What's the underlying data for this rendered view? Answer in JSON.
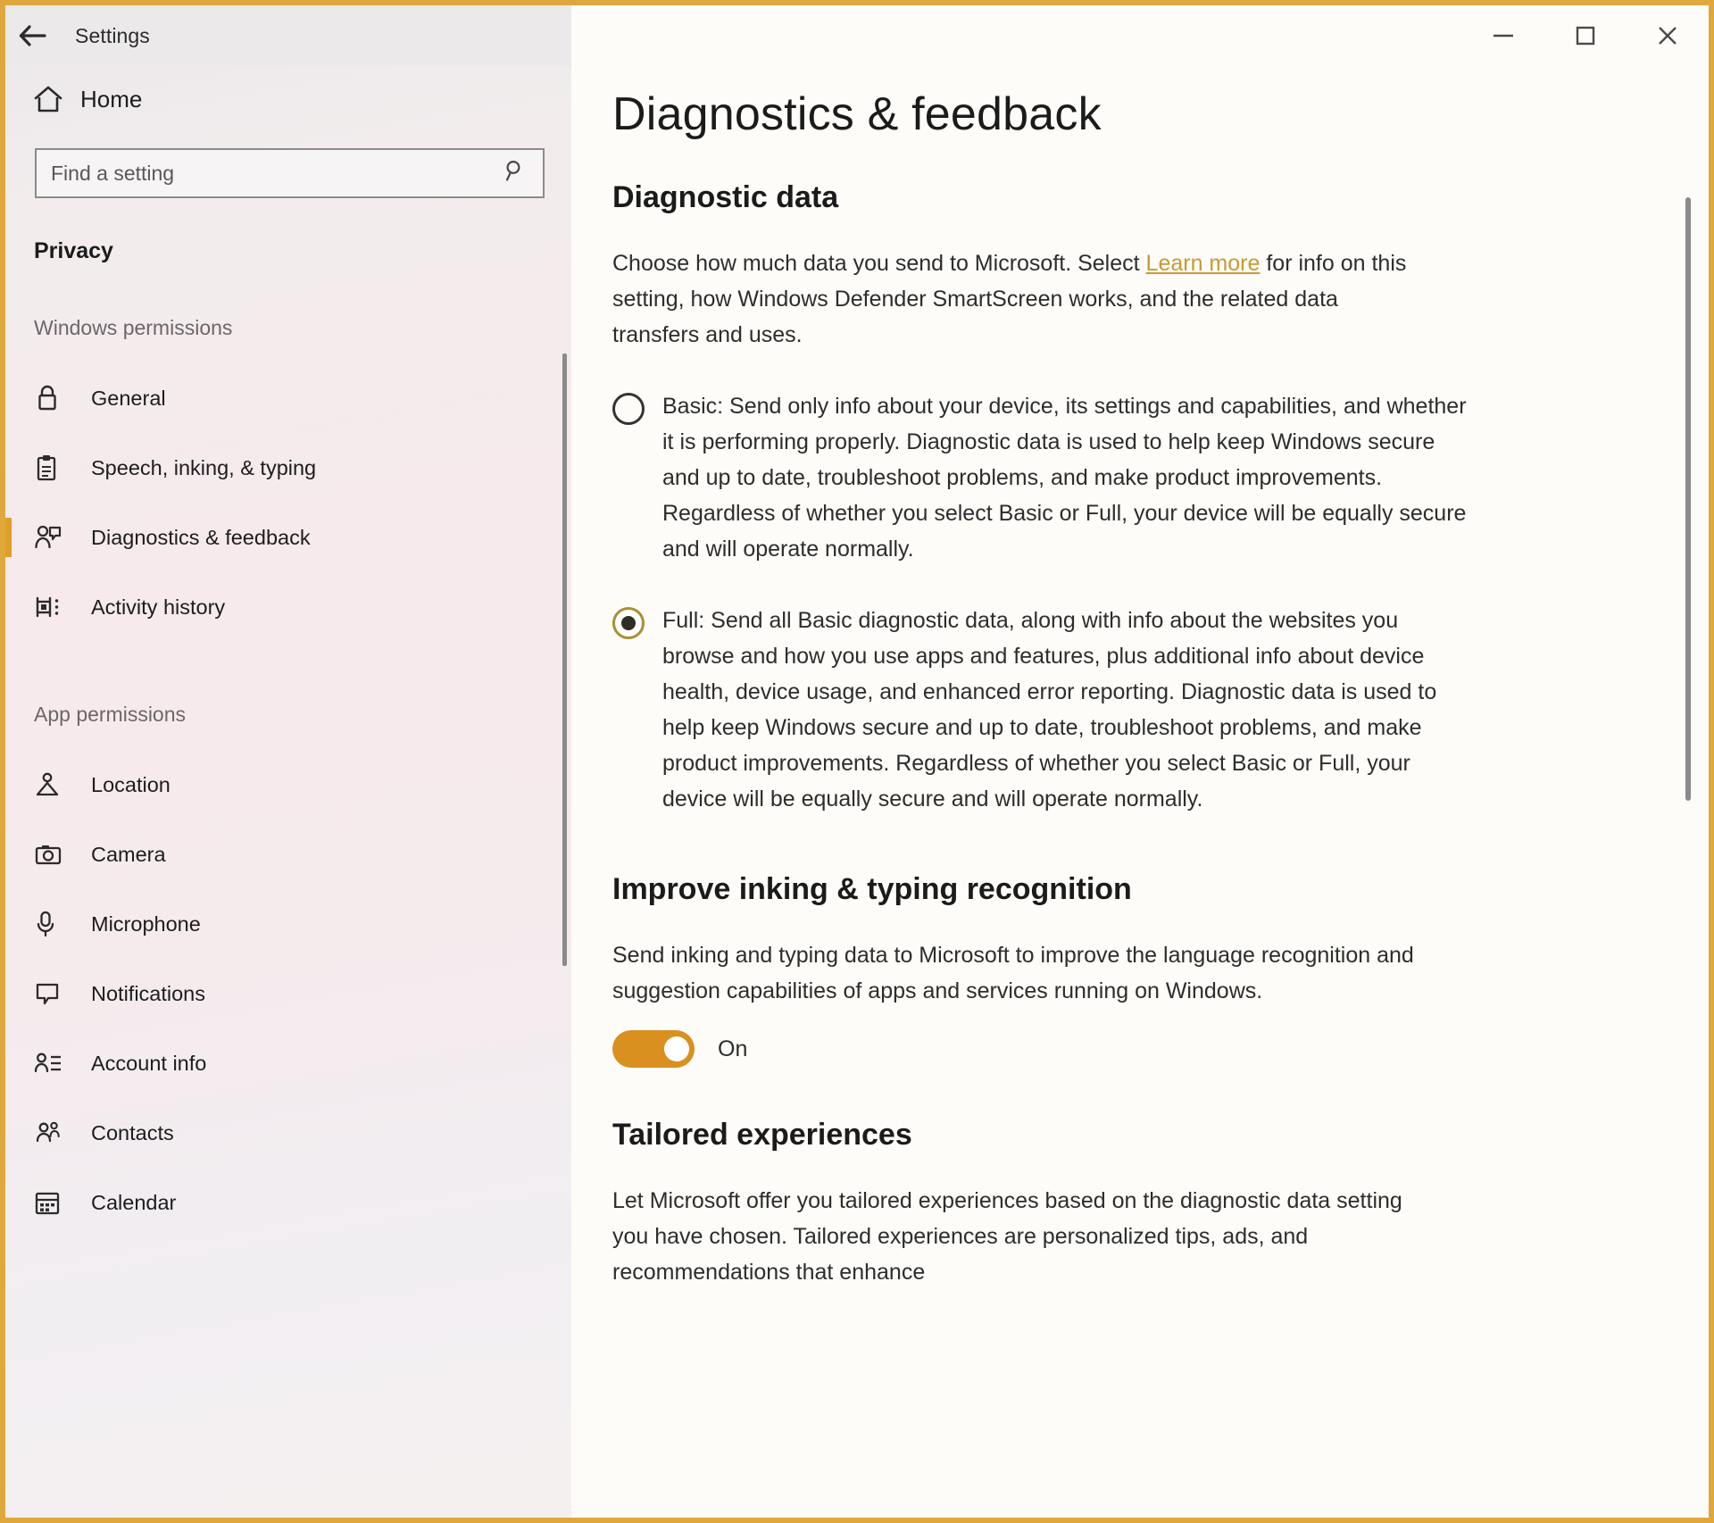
{
  "window": {
    "app_title": "Settings",
    "back_icon": "back-arrow-icon",
    "minimize_label": "—",
    "maximize_label": "□",
    "close_label": "✕"
  },
  "sidebar": {
    "home_label": "Home",
    "home_icon": "home-icon",
    "search": {
      "placeholder": "Find a setting",
      "value": "",
      "icon": "search-icon"
    },
    "category_title": "Privacy",
    "groups": [
      {
        "heading": "Windows permissions",
        "items": [
          {
            "label": "General",
            "icon": "lock-icon",
            "selected": false
          },
          {
            "label": "Speech, inking, & typing",
            "icon": "clipboard-icon",
            "selected": false
          },
          {
            "label": "Diagnostics & feedback",
            "icon": "feedback-person-icon",
            "selected": true
          },
          {
            "label": "Activity history",
            "icon": "activity-history-icon",
            "selected": false
          }
        ]
      },
      {
        "heading": "App permissions",
        "items": [
          {
            "label": "Location",
            "icon": "location-pin-icon",
            "selected": false
          },
          {
            "label": "Camera",
            "icon": "camera-icon",
            "selected": false
          },
          {
            "label": "Microphone",
            "icon": "microphone-icon",
            "selected": false
          },
          {
            "label": "Notifications",
            "icon": "notification-icon",
            "selected": false
          },
          {
            "label": "Account info",
            "icon": "account-info-icon",
            "selected": false
          },
          {
            "label": "Contacts",
            "icon": "contacts-icon",
            "selected": false
          },
          {
            "label": "Calendar",
            "icon": "calendar-icon",
            "selected": false
          }
        ]
      }
    ]
  },
  "main": {
    "page_title": "Diagnostics & feedback",
    "sections": {
      "diagnostic_data": {
        "heading": "Diagnostic data",
        "intro_before_link": "Choose how much data you send to Microsoft. Select ",
        "link_text": "Learn more",
        "intro_after_link": " for info on this setting, how Windows Defender SmartScreen works, and the related data transfers and uses.",
        "options": [
          {
            "id": "basic",
            "checked": false,
            "text": "Basic: Send only info about your device, its settings and capabilities, and whether it is performing properly. Diagnostic data is used to help keep Windows secure and up to date, troubleshoot problems, and make product improvements. Regardless of whether you select Basic or Full, your device will be equally secure and will operate normally."
          },
          {
            "id": "full",
            "checked": true,
            "text": "Full: Send all Basic diagnostic data, along with info about the websites you browse and how you use apps and features, plus additional info about device health, device usage, and enhanced error reporting. Diagnostic data is used to help keep Windows secure and up to date, troubleshoot problems, and make product improvements. Regardless of whether you select Basic or Full, your device will be equally secure and will operate normally."
          }
        ]
      },
      "inking": {
        "heading": "Improve inking & typing recognition",
        "description": "Send inking and typing data to Microsoft to improve the language recognition and suggestion capabilities of apps and services running on Windows.",
        "toggle_state": "On"
      },
      "tailored": {
        "heading": "Tailored experiences",
        "description": "Let Microsoft offer you tailored experiences based on the diagnostic data setting you have chosen. Tailored experiences are personalized tips, ads, and recommendations that enhance"
      }
    }
  },
  "colors": {
    "accent_orange": "#d9901f",
    "selection_bar": "#e0a026",
    "link_gold": "#c79a33",
    "frame_border": "#e0a83c"
  }
}
